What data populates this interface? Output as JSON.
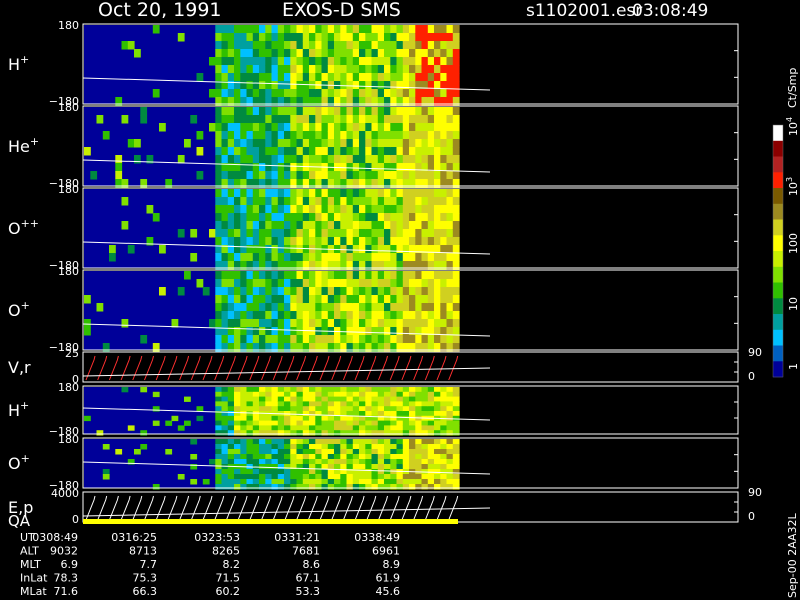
{
  "header": {
    "date": "Oct 20, 1991",
    "mission": "EXOS-D SMS",
    "file": "s1102001.esr",
    "time": "03:08:49"
  },
  "chart_data": {
    "type": "heatmap",
    "panels": [
      {
        "label_base": "H",
        "label_sup": "+",
        "ytop": "180",
        "ybot": "−180"
      },
      {
        "label_base": "He",
        "label_sup": "+",
        "ytop": "180",
        "ybot": "−180"
      },
      {
        "label_base": "O",
        "label_sup": "++",
        "ytop": "180",
        "ybot": "−180"
      },
      {
        "label_base": "O",
        "label_sup": "+",
        "ytop": "180",
        "ybot": "−180"
      },
      {
        "label_base": "V,r",
        "label_sup": "",
        "ytop": "25",
        "ybot": "0",
        "right_top": "90",
        "right_bot": "0"
      },
      {
        "label_base": "H",
        "label_sup": "+",
        "ytop": "180",
        "ybot": "−180"
      },
      {
        "label_base": "O",
        "label_sup": "+",
        "ytop": "180",
        "ybot": "−180"
      },
      {
        "label_base": "E,p",
        "label_sup": "",
        "ytop": "4000",
        "ybot": "0",
        "right_top": "90",
        "right_bot": "0"
      }
    ],
    "qa_label": "QA",
    "colorbar": {
      "title": "Ct/Smp",
      "scale": "log",
      "ticks": [
        {
          "label": "10",
          "sup": "4"
        },
        {
          "label": "10",
          "sup": "3"
        },
        {
          "label": "100",
          "sup": ""
        },
        {
          "label": "10",
          "sup": ""
        },
        {
          "label": "1",
          "sup": ""
        }
      ],
      "colors": [
        "#ffffff",
        "#8b0000",
        "#b22222",
        "#ff2000",
        "#7a5a00",
        "#9c8a20",
        "#d0d020",
        "#ffff00",
        "#c8f000",
        "#80e000",
        "#30c000",
        "#008a40",
        "#00a0a0",
        "#00c0ff",
        "#0060c0",
        "#000099"
      ]
    },
    "ephemeris": {
      "rows": [
        {
          "label": "UT",
          "values": [
            "0308:49",
            "0316:25",
            "0323:53",
            "0331:21",
            "0338:49"
          ]
        },
        {
          "label": "ALT",
          "values": [
            "9032",
            "8713",
            "8265",
            "7681",
            "6961"
          ]
        },
        {
          "label": "MLT",
          "values": [
            "6.9",
            "7.7",
            "8.2",
            "8.6",
            "8.9"
          ]
        },
        {
          "label": "InLat",
          "values": [
            "78.3",
            "75.3",
            "71.5",
            "67.1",
            "61.9"
          ]
        },
        {
          "label": "MLat",
          "values": [
            "71.6",
            "66.3",
            "60.2",
            "53.3",
            "45.6"
          ]
        }
      ]
    },
    "footer_note": "Sep-00 2AA32L"
  }
}
